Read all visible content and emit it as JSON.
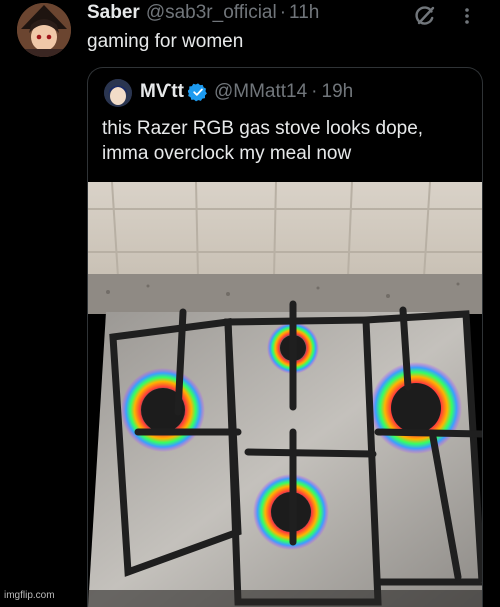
{
  "tweet": {
    "display_name": "Saber",
    "handle": "@sab3r_official",
    "separator": "·",
    "time": "11h",
    "text": "gaming for women"
  },
  "quoted_tweet": {
    "display_name": "MѴtt",
    "handle": "@MMatt14",
    "separator": "·",
    "time": "19h",
    "text_line1": "this Razer RGB gas stove looks dope,",
    "text_line2": "imma overclock my meal now"
  },
  "watermark": "imgflip.com",
  "colors": {
    "background": "#000000",
    "primary_text": "#e7e9ea",
    "secondary_text": "#71767b",
    "verified_blue": "#1d9bf0",
    "border": "#2f3336"
  },
  "icons": {
    "grok": "grok-icon",
    "more": "more-icon",
    "verified": "verified-badge-icon"
  }
}
